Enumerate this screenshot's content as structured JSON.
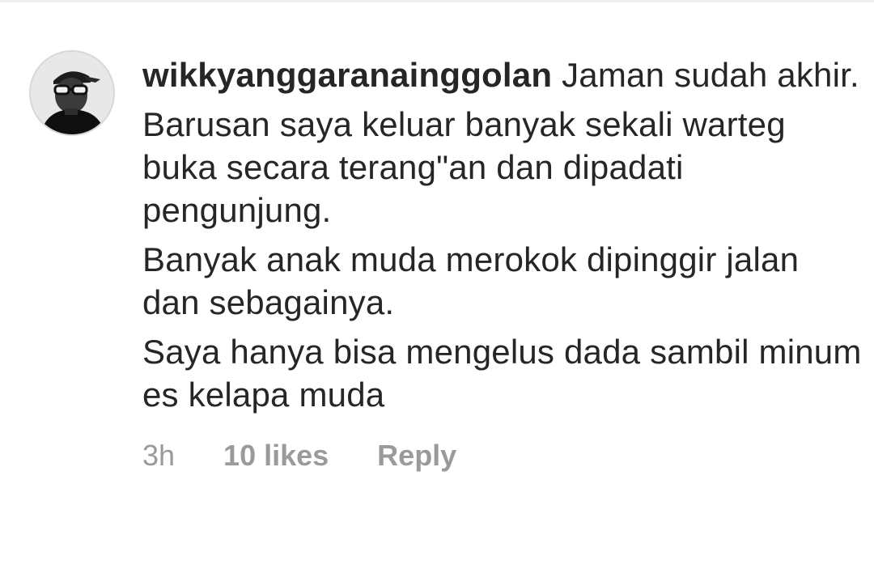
{
  "comment": {
    "avatar_icon": "user-avatar-photo",
    "username": "wikkyanggaranainggolan",
    "first_line_text": "Jaman sudah akhir.",
    "paragraphs": [
      "Barusan saya keluar banyak sekali warteg buka secara terang\"an dan dipadati pengunjung.",
      "Banyak anak muda merokok dipinggir jalan dan sebagainya.",
      "Saya hanya bisa mengelus dada sambil minum es kelapa muda"
    ],
    "time": "3h",
    "likes": "10 likes",
    "reply_label": "Reply"
  }
}
